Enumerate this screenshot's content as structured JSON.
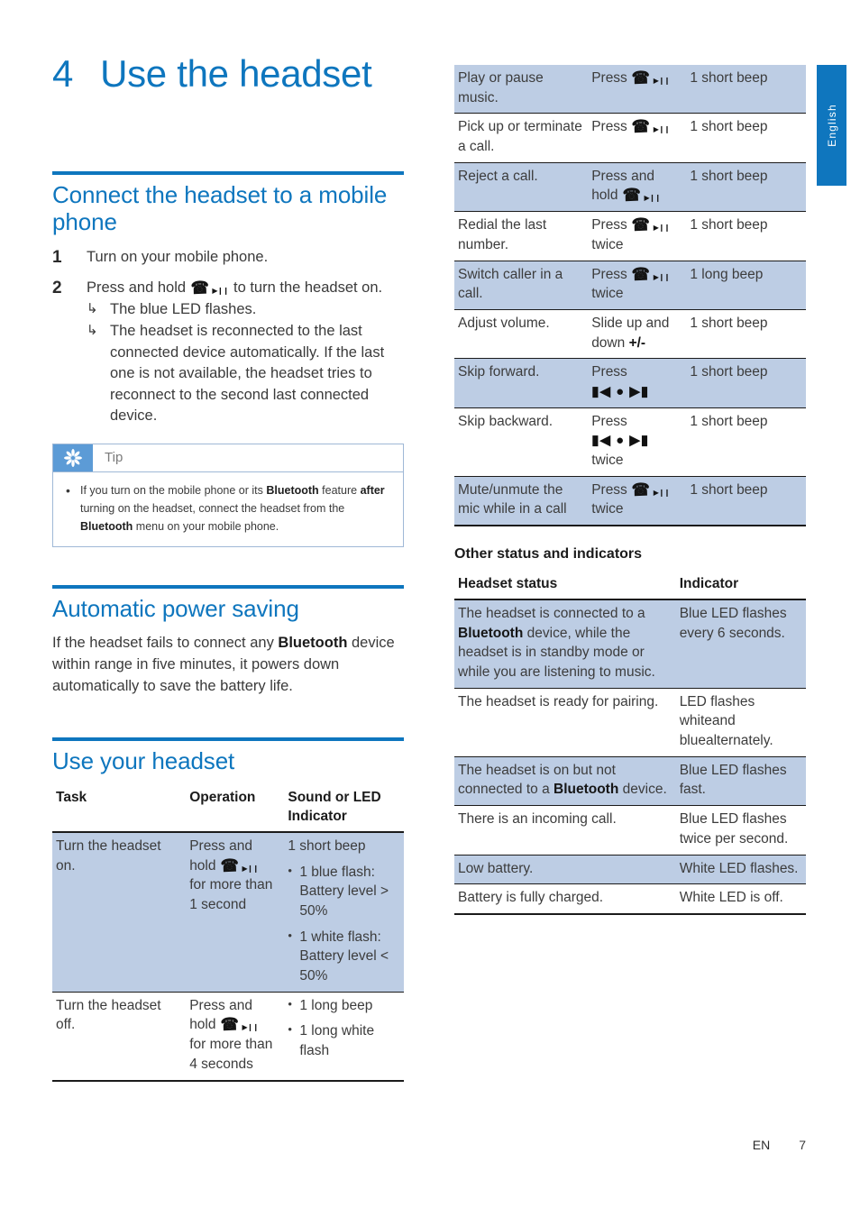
{
  "language_tab": {
    "label": "English"
  },
  "chapter": {
    "number": "4",
    "title": "Use the headset"
  },
  "section_connect": {
    "heading": "Connect the headset to a mobile phone",
    "steps": [
      {
        "num": "1",
        "text": "Turn on your mobile phone."
      },
      {
        "num": "2",
        "text_before": "Press and hold",
        "text_after": "to turn the headset on."
      }
    ],
    "results": [
      "The blue LED flashes.",
      "The headset is reconnected to the last connected device automatically. If the last one is not available, the headset tries to reconnect to the second last connected device."
    ],
    "tip": {
      "label": "Tip",
      "icon": "asterisk-icon",
      "text_1": "If you turn on the mobile phone or its ",
      "bold_1": "Bluetooth",
      "text_2": " feature ",
      "bold_2": "after",
      "text_3": " turning on the headset, connect the headset from the ",
      "bold_3": "Bluetooth",
      "text_4": " menu on your mobile phone."
    }
  },
  "section_power": {
    "heading": "Automatic power saving",
    "text_1": "If the headset fails to connect any ",
    "bold_1": "Bluetooth",
    "text_2": " device within range in five minutes, it powers down automatically to save the battery life."
  },
  "section_use": {
    "heading": "Use your headset",
    "columns": [
      "Task",
      "Operation",
      "Sound or LED Indicator"
    ],
    "rows": [
      {
        "task": "Turn the headset on.",
        "op_before": "Press and hold",
        "op_after": "for more than 1 second",
        "ind_plain": "1 short beep",
        "ind_bullets": [
          "1 blue flash: Battery level > 50%",
          "1 white flash: Battery level < 50%"
        ]
      },
      {
        "task": "Turn the headset off.",
        "op_before": "Press and hold",
        "op_after": "for more than 4 seconds",
        "ind_plain": "",
        "ind_bullets": [
          "1 long beep",
          "1 long white flash"
        ]
      },
      {
        "task": "Play or pause music.",
        "op_before": "Press",
        "op_after": "",
        "ind_plain": "1 short beep",
        "ind_bullets": []
      },
      {
        "task": "Pick up or terminate a call.",
        "op_before": "Press",
        "op_after": "",
        "ind_plain": "1 short beep",
        "ind_bullets": []
      },
      {
        "task": "Reject a call.",
        "op_before": "Press and hold",
        "op_after": "",
        "ind_plain": "1 short beep",
        "ind_bullets": []
      },
      {
        "task": "Redial the last number.",
        "op_before": "Press",
        "op_after": "twice",
        "ind_plain": "1 short beep",
        "ind_bullets": []
      },
      {
        "task": "Switch caller in a call.",
        "op_before": "Press",
        "op_after": "twice",
        "ind_plain": "1 long beep",
        "ind_bullets": []
      },
      {
        "task": "Adjust volume.",
        "op_before": "Slide up and down",
        "op_plusminus": "+/-",
        "op_after": "",
        "ind_plain": "1 short beep",
        "ind_bullets": []
      },
      {
        "task": "Skip forward.",
        "op_before": "Press",
        "op_skip": true,
        "op_after": "",
        "ind_plain": "1 short beep",
        "ind_bullets": []
      },
      {
        "task": "Skip backward.",
        "op_before": "Press",
        "op_skip": true,
        "op_after": "twice",
        "ind_plain": "1 short beep",
        "ind_bullets": []
      },
      {
        "task": "Mute/unmute the mic while in a call",
        "op_before": "Press",
        "op_after": "twice",
        "ind_plain": "1 short beep",
        "ind_bullets": []
      }
    ]
  },
  "section_status": {
    "heading": "Other status and indicators",
    "columns": [
      "Headset status",
      "Indicator"
    ],
    "rows": [
      {
        "status_1": "The headset is connected to a ",
        "status_bold": "Bluetooth",
        "status_2": " device, while the headset is in standby mode or while you are listening to music.",
        "indicator": "Blue LED flashes every 6 seconds."
      },
      {
        "status_1": "The headset is ready for pairing.",
        "status_bold": "",
        "status_2": "",
        "indicator": "LED flashes whiteand bluealternately."
      },
      {
        "status_1": "The headset is on but not connected to a ",
        "status_bold": "Bluetooth",
        "status_2": " device.",
        "indicator": "Blue LED flashes fast."
      },
      {
        "status_1": "There is an incoming call.",
        "status_bold": "",
        "status_2": "",
        "indicator": "Blue LED flashes twice per second."
      },
      {
        "status_1": "Low battery.",
        "status_bold": "",
        "status_2": "",
        "indicator": "White LED flashes."
      },
      {
        "status_1": "Battery is fully charged.",
        "status_bold": "",
        "status_2": "",
        "indicator": "White LED is off."
      }
    ]
  },
  "footer": {
    "lang_code": "EN",
    "page_number": "7"
  },
  "colors": {
    "brand_blue": "#0E76BE",
    "row_shade": "#BDCDE4",
    "tip_badge": "#5C9BD6"
  }
}
